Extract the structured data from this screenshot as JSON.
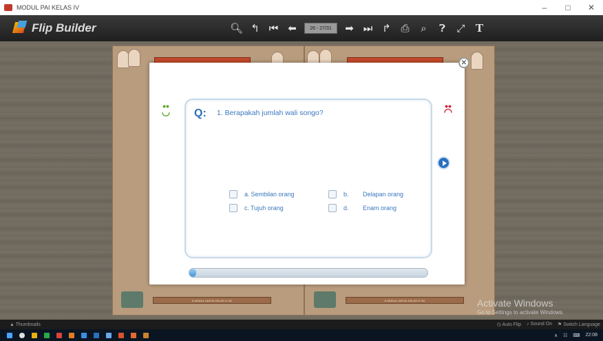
{
  "window": {
    "title": "MODUL PAI KELAS IV",
    "minimize": "–",
    "maximize": "□",
    "close": "✕"
  },
  "toolbar": {
    "brand": "Flip Builder",
    "page_indicator": "26 - 27/31",
    "icons": [
      "zoom-icon",
      "undo-icon",
      "first-page-icon",
      "prev-page-icon",
      "next-page-icon",
      "last-page-icon",
      "share-icon",
      "print-icon",
      "search-icon",
      "help-icon",
      "fullscreen-icon",
      "text-icon"
    ]
  },
  "book": {
    "footer_left": "E-MODUL UNTUK KELAS IV SD",
    "footer_right": "E-MODUL UNTUK KELAS IV SD"
  },
  "watermark": {
    "line1": "Activate Windows",
    "line2": "Go to Settings to activate Windows."
  },
  "quiz": {
    "q_label": "Q:",
    "question": "1.  Berapakah jumlah  wali songo?",
    "options": [
      {
        "letter": "a.",
        "text": "Sembilan orang"
      },
      {
        "letter": "b.",
        "text": "Delapan orang"
      },
      {
        "letter": "c.",
        "text": "Tujuh orang"
      },
      {
        "letter": "d.",
        "text": "Enam orang"
      }
    ],
    "progress_fraction": 0.03,
    "colors": {
      "accent": "#2a6fb8",
      "happy": "#5aaa2d",
      "sad": "#d2233a"
    }
  },
  "status": {
    "thumbnails": "Thumbnails",
    "auto_flip": "Auto Flip",
    "sound": "Sound On",
    "switch_language": "Switch Language"
  },
  "taskbar": {
    "time": "22:08"
  }
}
